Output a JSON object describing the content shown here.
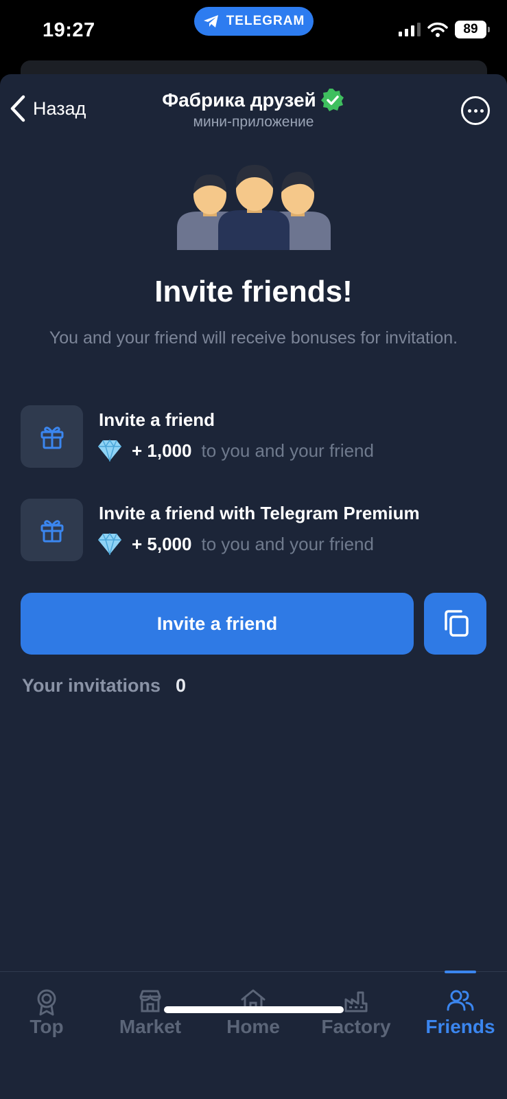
{
  "status_bar": {
    "time": "19:27",
    "app_pill": "TELEGRAM",
    "battery": "89"
  },
  "header": {
    "back_label": "Назад",
    "title": "Фабрика друзей",
    "subtitle": "мини-приложение"
  },
  "main": {
    "heading": "Invite friends!",
    "subheading": "You and your friend will receive bonuses for invitation.",
    "rewards": [
      {
        "title": "Invite a friend",
        "amount": "+ 1,000",
        "suffix": "to you and your friend",
        "icon": "gift-icon"
      },
      {
        "title": "Invite a friend with Telegram Premium",
        "amount": "+ 5,000",
        "suffix": "to you and your friend",
        "icon": "gift-icon"
      }
    ],
    "invite_button": "Invite a friend",
    "invitations_label": "Your invitations",
    "invitations_count": "0"
  },
  "tabs": [
    {
      "label": "Top",
      "icon": "medal-icon"
    },
    {
      "label": "Market",
      "icon": "store-icon"
    },
    {
      "label": "Home",
      "icon": "home-icon"
    },
    {
      "label": "Factory",
      "icon": "factory-icon"
    },
    {
      "label": "Friends",
      "icon": "friends-icon",
      "active": true
    }
  ],
  "colors": {
    "background": "#1c2538",
    "accent": "#2f7ae5",
    "muted_text": "#7c8598",
    "card": "#2f3a4e"
  }
}
